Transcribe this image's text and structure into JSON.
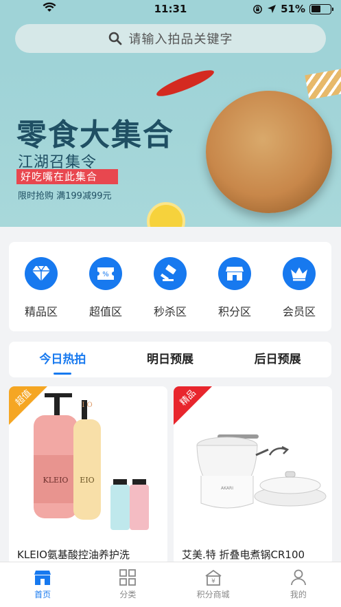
{
  "status_bar": {
    "time": "11:31",
    "battery": "51%"
  },
  "search": {
    "placeholder": "请输入拍品关键字"
  },
  "banner": {
    "title": "零食大集合",
    "subtitle": "江湖召集令",
    "tag": "好吃嘴在此集合",
    "note": "限时抢购   满199减99元"
  },
  "categories": [
    {
      "label": "精品区",
      "icon": "diamond-icon"
    },
    {
      "label": "超值区",
      "icon": "ticket-icon"
    },
    {
      "label": "秒杀区",
      "icon": "gavel-icon"
    },
    {
      "label": "积分区",
      "icon": "store-icon"
    },
    {
      "label": "会员区",
      "icon": "crown-icon"
    }
  ],
  "tabs": [
    {
      "label": "今日热拍",
      "active": true
    },
    {
      "label": "明日预展",
      "active": false
    },
    {
      "label": "后日预展",
      "active": false
    }
  ],
  "products": [
    {
      "badge": "超值",
      "badge_color": "#f5a623",
      "name": "KLEIO氨基酸控油养护洗"
    },
    {
      "badge": "精品",
      "badge_color": "#e8262d",
      "name": "艾美.特 折叠电煮锅CR100"
    }
  ],
  "nav": [
    {
      "label": "首页",
      "icon": "home-icon",
      "active": true
    },
    {
      "label": "分类",
      "icon": "grid-icon",
      "active": false
    },
    {
      "label": "积分商城",
      "icon": "points-mall-icon",
      "active": false
    },
    {
      "label": "我的",
      "icon": "user-icon",
      "active": false
    }
  ],
  "colors": {
    "accent": "#1779ef",
    "banner_bg": "#9fd3d7",
    "badge_orange": "#f5a623",
    "badge_red": "#e8262d"
  }
}
